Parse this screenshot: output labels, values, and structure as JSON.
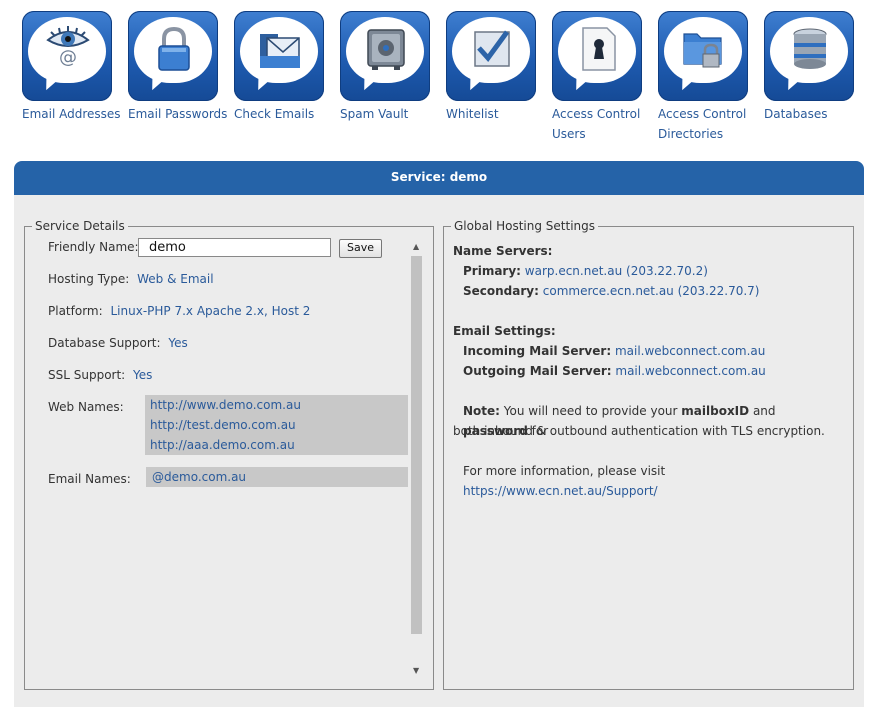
{
  "toolbar": {
    "items": [
      {
        "label": "Email Addresses",
        "icon": "eye-email-icon"
      },
      {
        "label": "Email Passwords",
        "icon": "padlock-icon"
      },
      {
        "label": "Check Emails",
        "icon": "envelope-folder-icon"
      },
      {
        "label": "Spam Vault",
        "icon": "vault-safe-icon"
      },
      {
        "label": "Whitelist",
        "icon": "checkmark-icon"
      },
      {
        "label": "Access Control Users",
        "icon": "keyhole-document-icon"
      },
      {
        "label": "Access Control Directories",
        "icon": "locked-folder-icon"
      },
      {
        "label": "Databases",
        "icon": "database-icon"
      }
    ]
  },
  "service": {
    "title": "Service: demo"
  },
  "service_details": {
    "legend": "Service Details",
    "friendly_name_label": "Friendly Name:",
    "friendly_name_value": "demo",
    "save_label": "Save",
    "hosting_type_label": "Hosting Type:",
    "hosting_type_value": "Web & Email",
    "platform_label": "Platform:",
    "platform_value": "Linux-PHP 7.x Apache 2.x, Host 2",
    "database_label": "Database Support:",
    "database_value": "Yes",
    "ssl_label": "SSL Support:",
    "ssl_value": "Yes",
    "web_names_label": "Web Names:",
    "web_names": [
      "http://www.demo.com.au",
      "http://test.demo.com.au",
      "http://aaa.demo.com.au"
    ],
    "email_names_label": "Email Names:",
    "email_names": [
      "@demo.com.au"
    ]
  },
  "global_settings": {
    "legend": "Global Hosting Settings",
    "name_servers_heading": "Name Servers:",
    "primary_label": "Primary:",
    "primary_value": "warp.ecn.net.au (203.22.70.2)",
    "secondary_label": "Secondary:",
    "secondary_value": "commerce.ecn.net.au (203.22.70.7)",
    "email_settings_heading": "Email Settings:",
    "incoming_label": "Incoming Mail Server:",
    "incoming_value": "mail.webconnect.com.au",
    "outgoing_label": "Outgoing Mail Server:",
    "outgoing_value": "mail.webconnect.com.au",
    "note_label": "Note:",
    "note_text_1": "You will need to provide your",
    "note_mailbox": "mailboxID",
    "note_and": "and",
    "note_password": "password",
    "note_text_2": "for",
    "note_text_3": "both inbound & outbound authentication with TLS encryption.",
    "more_info_text": "For more information, please visit",
    "more_info_link": "https://www.ecn.net.au/Support/"
  },
  "colors": {
    "brand_blue": "#2563a8",
    "link": "#2a5a9a",
    "panel_bg": "#ececec",
    "list_bg": "#c8c8c8"
  }
}
